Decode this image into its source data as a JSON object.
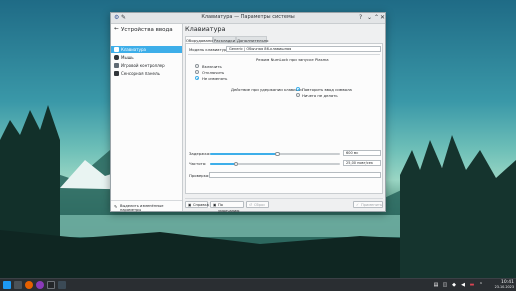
{
  "window": {
    "title": "Клавиатура — Параметры системы",
    "controls": {
      "help": "?",
      "minimize": "⌄",
      "maximize": "⌃",
      "close": "✕"
    }
  },
  "sidebar": {
    "back": "←",
    "title": "Устройства ввода",
    "items": [
      {
        "label": "Клавиатура",
        "icon": "keyboard-icon"
      },
      {
        "label": "Мышь",
        "icon": "mouse-icon"
      },
      {
        "label": "Игровой контроллер",
        "icon": "gamepad-icon"
      },
      {
        "label": "Сенсорная панель",
        "icon": "touchpad-icon"
      }
    ],
    "footer": "Выделить изменённые параметры"
  },
  "main": {
    "title": "Клавиатура",
    "tabs": [
      {
        "label": "Оборудование",
        "selected": true
      },
      {
        "label": "Раскладки",
        "selected": false
      },
      {
        "label": "Дополнительно",
        "selected": false
      }
    ],
    "model_label": "Модель клавиатуры:",
    "model_value": "Generic | Обычная 86-клавишная",
    "numlock": {
      "heading": "Режим NumLock при запуске Plasma",
      "options": [
        {
          "label": "Включить",
          "selected": false
        },
        {
          "label": "Отключить",
          "selected": false
        },
        {
          "label": "Не изменять",
          "selected": true
        }
      ]
    },
    "hold": {
      "label": "Действие при удержании клавиши:",
      "options": [
        {
          "label": "Повторить ввод символа",
          "selected": true
        },
        {
          "label": "Ничего не делать",
          "selected": false
        }
      ]
    },
    "delay": {
      "label": "Задержка:",
      "value": "600 мс",
      "fraction": 0.52
    },
    "rate": {
      "label": "Частота:",
      "value": "25,00 повт/сек",
      "fraction": 0.2
    },
    "test": {
      "label": "Проверка:",
      "placeholder": ""
    }
  },
  "buttons": {
    "help": "Справка",
    "defaults": "По умолчанию",
    "reset": "Сброс",
    "apply": "Применить"
  },
  "taskbar": {
    "time": "10:41",
    "date": "23.10.2023"
  }
}
